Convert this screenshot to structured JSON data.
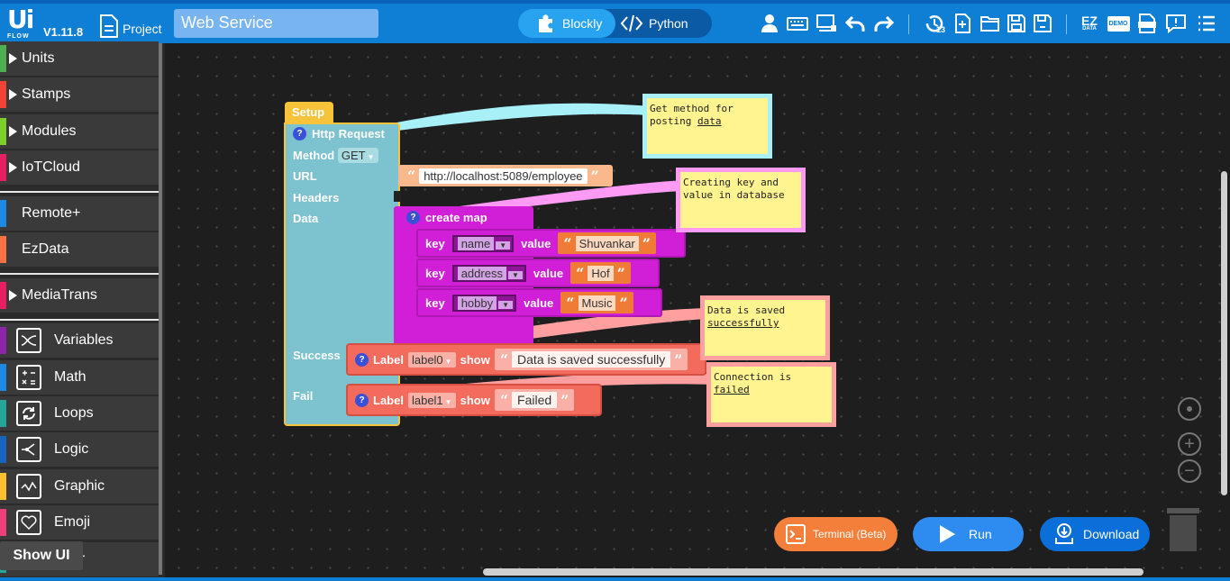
{
  "app": {
    "logo": "Ui",
    "logo_sub": "FLOW",
    "version": "V1.11.8",
    "project_label": "Project",
    "project_name": "Web Service",
    "mode_blockly": "Blockly",
    "mode_python": "Python",
    "history_count": "13",
    "ez_label": "EZ",
    "ez_sub": "DATA",
    "demo_label": "DEMO",
    "doc_label": "DOC"
  },
  "sidebar": {
    "categories": [
      {
        "label": "Units",
        "color": "#4caf50"
      },
      {
        "label": "Stamps",
        "color": "#f44336"
      },
      {
        "label": "Modules",
        "color": "#7cd02a"
      },
      {
        "label": "IoTCloud",
        "color": "#e91e63"
      },
      {
        "label": "Remote+",
        "color": "#1e88e5"
      },
      {
        "label": "EzData",
        "color": "#ff7043"
      },
      {
        "label": "MediaTrans",
        "color": "#e91e63"
      },
      {
        "label": "Variables",
        "color": "#8e24aa"
      },
      {
        "label": "Math",
        "color": "#1e88e5"
      },
      {
        "label": "Loops",
        "color": "#26a69a"
      },
      {
        "label": "Logic",
        "color": "#1565c0"
      },
      {
        "label": "Graphic",
        "color": "#fbc02d"
      },
      {
        "label": "Emoji",
        "color": "#ec407a"
      },
      {
        "label": "er",
        "color": "#26a69a"
      }
    ],
    "show_ui": "Show UI"
  },
  "blocks": {
    "setup": "Setup",
    "http_title": "Http Request",
    "method_label": "Method",
    "method_value": "GET",
    "url_label": "URL",
    "url_value": "http://localhost:5089/employee",
    "headers_label": "Headers",
    "data_label": "Data",
    "success_label": "Success",
    "fail_label": "Fail",
    "map_title": "create map",
    "key_label": "key",
    "value_label": "value",
    "show_label": "show",
    "label_word": "Label",
    "pairs": [
      {
        "key": "name",
        "value": "Shuvankar"
      },
      {
        "key": "address",
        "value": "Hof"
      },
      {
        "key": "hobby",
        "value": "Music"
      }
    ],
    "success_label_name": "label0",
    "success_text": "Data is saved successfully",
    "fail_label_name": "label1",
    "fail_text": "Failed"
  },
  "notes": {
    "n1a": "Get method for",
    "n1b": "posting ",
    "n1c": "data",
    "n2a": "Creating key and",
    "n2b": "value in database",
    "n3a": "Data is saved",
    "n3b": "successfully",
    "n4a": "Connection is",
    "n4b": "failed"
  },
  "buttons": {
    "terminal": "Terminal (Beta)",
    "run": "Run",
    "download": "Download"
  },
  "colors": {
    "topbar": "#0e7fd4",
    "terminal": "#f47f3a",
    "run": "#2e8cf0",
    "download": "#0a6fd8"
  }
}
